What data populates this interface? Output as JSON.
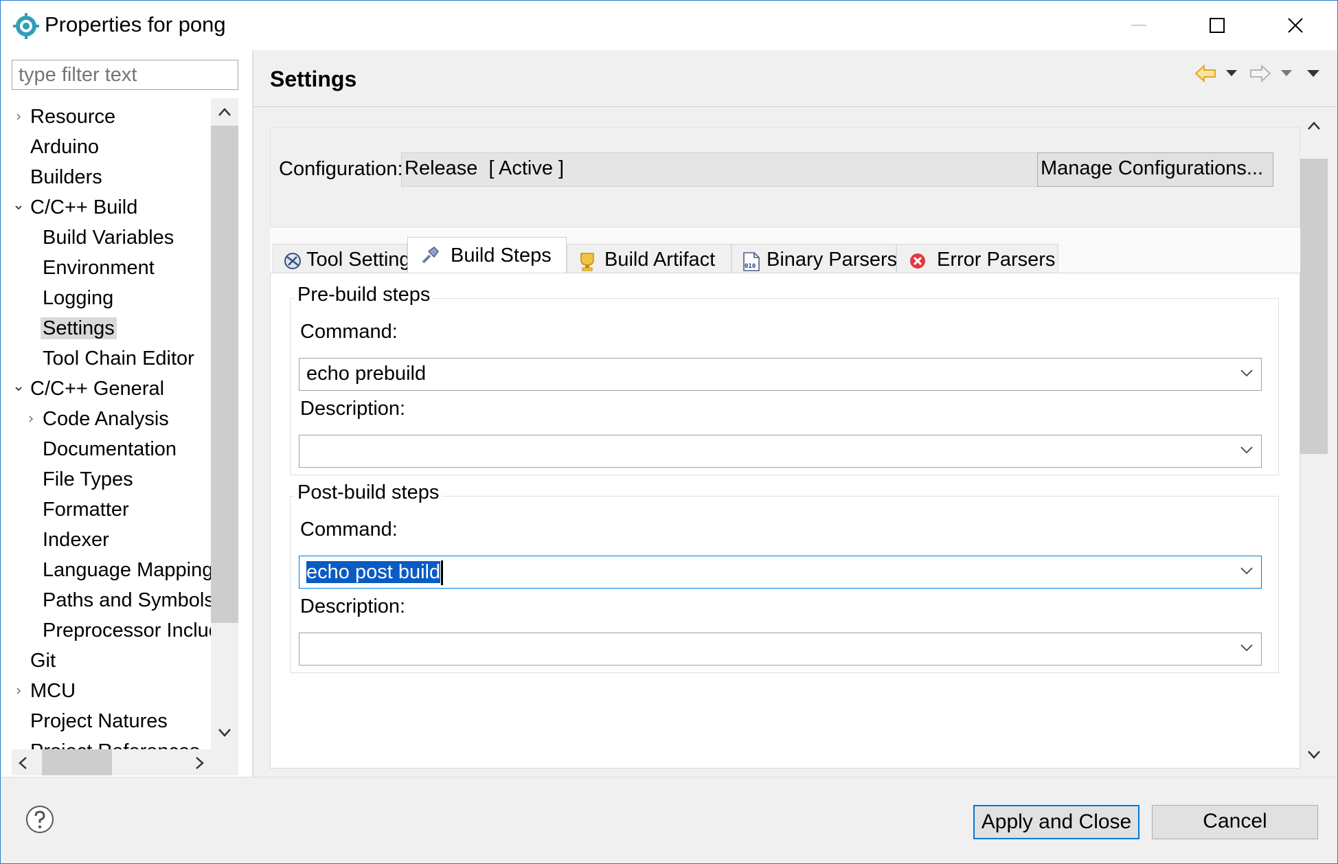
{
  "window": {
    "title": "Properties for pong"
  },
  "filter": {
    "placeholder": "type filter text"
  },
  "tree": {
    "items": [
      {
        "label": "Resource",
        "level": 0,
        "twisty": "collapsed"
      },
      {
        "label": "Arduino",
        "level": 0,
        "twisty": "none"
      },
      {
        "label": "Builders",
        "level": 0,
        "twisty": "none"
      },
      {
        "label": "C/C++ Build",
        "level": 0,
        "twisty": "expanded"
      },
      {
        "label": "Build Variables",
        "level": 1,
        "twisty": "none"
      },
      {
        "label": "Environment",
        "level": 1,
        "twisty": "none"
      },
      {
        "label": "Logging",
        "level": 1,
        "twisty": "none"
      },
      {
        "label": "Settings",
        "level": 1,
        "twisty": "none",
        "selected": true
      },
      {
        "label": "Tool Chain Editor",
        "level": 1,
        "twisty": "none"
      },
      {
        "label": "C/C++ General",
        "level": 0,
        "twisty": "expanded"
      },
      {
        "label": "Code Analysis",
        "level": 1,
        "twisty": "collapsed"
      },
      {
        "label": "Documentation",
        "level": 1,
        "twisty": "none"
      },
      {
        "label": "File Types",
        "level": 1,
        "twisty": "none"
      },
      {
        "label": "Formatter",
        "level": 1,
        "twisty": "none"
      },
      {
        "label": "Indexer",
        "level": 1,
        "twisty": "none"
      },
      {
        "label": "Language Mappings",
        "level": 1,
        "twisty": "none"
      },
      {
        "label": "Paths and Symbols",
        "level": 1,
        "twisty": "none"
      },
      {
        "label": "Preprocessor Include Paths",
        "level": 1,
        "twisty": "none"
      },
      {
        "label": "Git",
        "level": 0,
        "twisty": "none"
      },
      {
        "label": "MCU",
        "level": 0,
        "twisty": "collapsed"
      },
      {
        "label": "Project Natures",
        "level": 0,
        "twisty": "none"
      },
      {
        "label": "Project References",
        "level": 0,
        "twisty": "none"
      }
    ]
  },
  "page": {
    "title": "Settings"
  },
  "config": {
    "label": "Configuration:",
    "value": "Release  [ Active ]",
    "manage_label": "Manage Configurations..."
  },
  "tabs": [
    {
      "label": "Tool Settings",
      "icon": "tool-settings-icon"
    },
    {
      "label": "Build Steps",
      "icon": "build-steps-icon",
      "active": true
    },
    {
      "label": "Build Artifact",
      "icon": "build-artifact-icon"
    },
    {
      "label": "Binary Parsers",
      "icon": "binary-parsers-icon"
    },
    {
      "label": "Error Parsers",
      "icon": "error-parsers-icon"
    }
  ],
  "prebuild": {
    "title": "Pre-build steps",
    "command_label": "Command:",
    "command_value": "echo prebuild",
    "description_label": "Description:",
    "description_value": ""
  },
  "postbuild": {
    "title": "Post-build steps",
    "command_label": "Command:",
    "command_value": "echo post build",
    "description_label": "Description:",
    "description_value": ""
  },
  "buttons": {
    "apply_close": "Apply and Close",
    "cancel": "Cancel"
  },
  "colors": {
    "accent": "#0078d7",
    "selection": "#0a5bc4",
    "back_arrow": "#e0a526",
    "error": "#e0393e"
  }
}
